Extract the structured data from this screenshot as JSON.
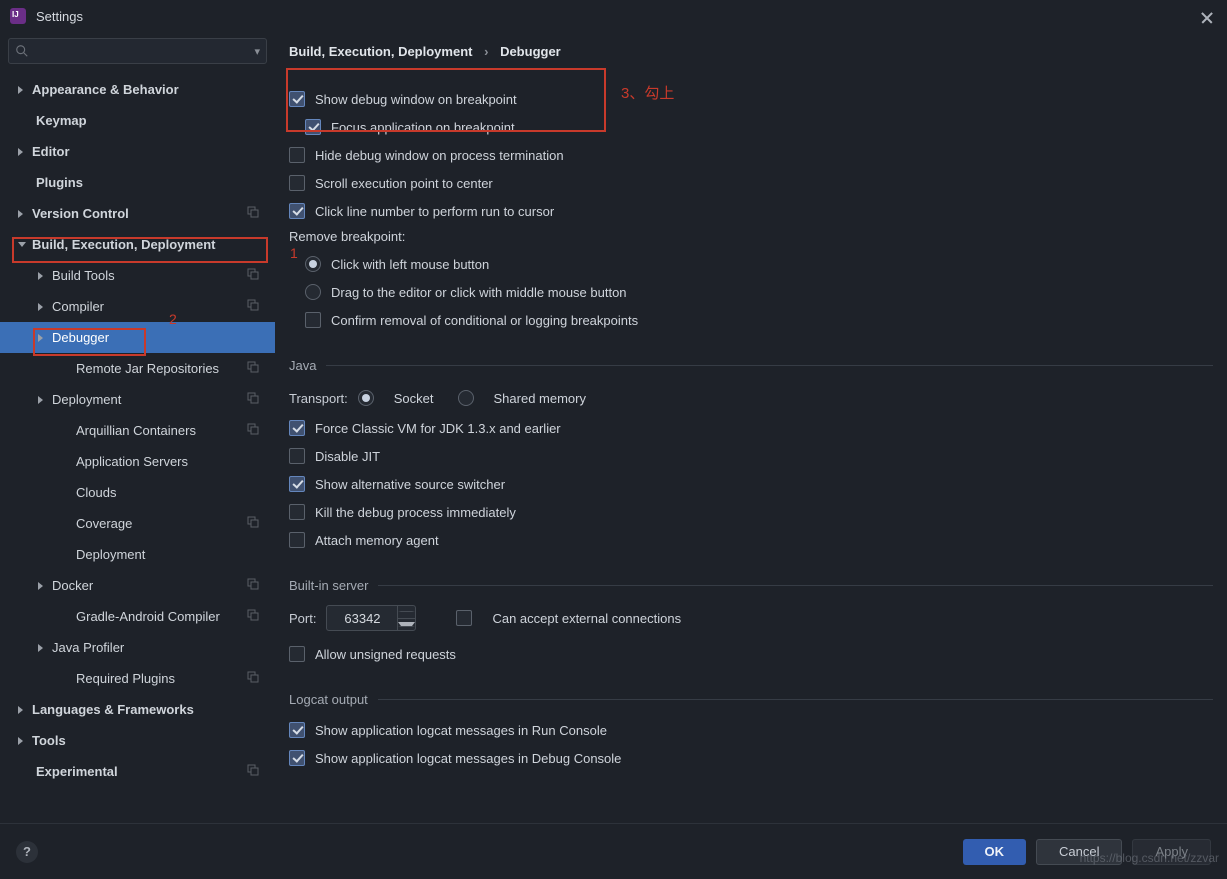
{
  "window": {
    "title": "Settings"
  },
  "search": {
    "placeholder": ""
  },
  "sidebar": [
    {
      "l": 0,
      "exp": "right",
      "label": "Appearance & Behavior",
      "bold": true
    },
    {
      "l": 0,
      "exp": null,
      "label": "Keymap",
      "bold": true,
      "noarw": true
    },
    {
      "l": 0,
      "exp": "right",
      "label": "Editor",
      "bold": true
    },
    {
      "l": 0,
      "exp": null,
      "label": "Plugins",
      "bold": true,
      "noarw": true
    },
    {
      "l": 0,
      "exp": "right",
      "label": "Version Control",
      "bold": true,
      "copy": true
    },
    {
      "l": 0,
      "exp": "down",
      "label": "Build, Execution, Deployment",
      "bold": true
    },
    {
      "l": 1,
      "exp": "right",
      "label": "Build Tools",
      "copy": true
    },
    {
      "l": 1,
      "exp": "right",
      "label": "Compiler",
      "copy": true
    },
    {
      "l": 1,
      "exp": "right",
      "label": "Debugger",
      "selected": true
    },
    {
      "l": 2,
      "exp": null,
      "label": "Remote Jar Repositories",
      "noarw": true,
      "copy": true
    },
    {
      "l": 1,
      "exp": "right",
      "label": "Deployment",
      "copy": true
    },
    {
      "l": 2,
      "exp": null,
      "label": "Arquillian Containers",
      "noarw": true,
      "copy": true
    },
    {
      "l": 2,
      "exp": null,
      "label": "Application Servers",
      "noarw": true
    },
    {
      "l": 2,
      "exp": null,
      "label": "Clouds",
      "noarw": true
    },
    {
      "l": 2,
      "exp": null,
      "label": "Coverage",
      "noarw": true,
      "copy": true
    },
    {
      "l": 2,
      "exp": null,
      "label": "Deployment",
      "noarw": true
    },
    {
      "l": 1,
      "exp": "right",
      "label": "Docker",
      "copy": true
    },
    {
      "l": 2,
      "exp": null,
      "label": "Gradle-Android Compiler",
      "noarw": true,
      "copy": true
    },
    {
      "l": 1,
      "exp": "right",
      "label": "Java Profiler"
    },
    {
      "l": 2,
      "exp": null,
      "label": "Required Plugins",
      "noarw": true,
      "copy": true
    },
    {
      "l": 0,
      "exp": "right",
      "label": "Languages & Frameworks",
      "bold": true
    },
    {
      "l": 0,
      "exp": "right",
      "label": "Tools",
      "bold": true
    },
    {
      "l": 0,
      "exp": null,
      "label": "Experimental",
      "bold": true,
      "noarw": true,
      "copy": true
    }
  ],
  "breadcrumb": {
    "a": "Build, Execution, Deployment",
    "b": "Debugger",
    "sep": "›"
  },
  "opts": {
    "show_on_bp": "Show debug window on breakpoint",
    "focus_on_bp": "Focus application on breakpoint",
    "hide_on_term": "Hide debug window on process termination",
    "scroll_center": "Scroll execution point to center",
    "click_line_run": "Click line number to perform run to cursor",
    "remove_bp_title": "Remove breakpoint:",
    "remove_left": "Click with left mouse button",
    "remove_drag": "Drag to the editor or click with middle mouse button",
    "confirm_removal": "Confirm removal of conditional or logging breakpoints"
  },
  "java": {
    "title": "Java",
    "transport": "Transport:",
    "socket": "Socket",
    "shared": "Shared memory",
    "force_classic": "Force Classic VM for JDK 1.3.x and earlier",
    "disable_jit": "Disable JIT",
    "alt_source": "Show alternative source switcher",
    "kill_immediate": "Kill the debug process immediately",
    "attach_mem": "Attach memory agent"
  },
  "server": {
    "title": "Built-in server",
    "port_label": "Port:",
    "port_value": "63342",
    "accept_ext": "Can accept external connections",
    "allow_unsigned": "Allow unsigned requests"
  },
  "logcat": {
    "title": "Logcat output",
    "run": "Show application logcat messages in Run Console",
    "debug": "Show application logcat messages in Debug Console"
  },
  "annot": {
    "n1": "1",
    "n2": "2",
    "n3": "3、勾上"
  },
  "footer": {
    "ok": "OK",
    "cancel": "Cancel",
    "apply": "Apply",
    "help": "?"
  },
  "watermark": "https://blog.csdn.net/zzvar"
}
